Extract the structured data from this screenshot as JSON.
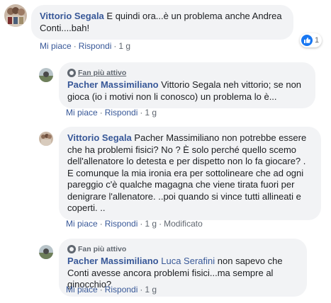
{
  "comments": [
    {
      "author": "Vittorio Segala",
      "text": "E quindi ora...è un problema anche Andrea Conti....bah!",
      "actions": {
        "like": "Mi piace",
        "reply": "Rispondi",
        "time": "1 g"
      },
      "reaction_count": "1"
    },
    {
      "badge": "Fan più attivo",
      "author": "Pacher Massimiliano",
      "text": "Vittorio Segala neh vittorio; se non gioca (io i motivi non li conosco) un problema lo è...",
      "actions": {
        "like": "Mi piace",
        "reply": "Rispondi",
        "time": "1 g"
      }
    },
    {
      "author": "Vittorio Segala",
      "text": "Pacher Massimiliano non potrebbe essere che ha problemi fisici? No ? È solo perché quello scemo dell'allenatore lo detesta e per dispetto non lo fa giocare? . E comunque la mia ironia era per sottolineare che ad ogni pareggio c'è qualche magagna che viene tirata fuori per denigrare l'allenatore. ..poi quando si vince tutti allineati e coperti. ..",
      "actions": {
        "like": "Mi piace",
        "reply": "Rispondi",
        "time": "1 g",
        "edited": "Modificato"
      }
    },
    {
      "badge": "Fan più attivo",
      "author": "Pacher Massimiliano",
      "mention": "Luca Serafini",
      "text": "non sapevo che Conti avesse ancora problemi fisici...ma sempre al ginocchio?",
      "actions": {
        "like": "Mi piace",
        "reply": "Rispondi",
        "time": "1 g"
      }
    }
  ],
  "colors": {
    "link": "#385898",
    "bubble": "#f2f3f5",
    "like": "#1877f2",
    "meta": "#606770"
  }
}
